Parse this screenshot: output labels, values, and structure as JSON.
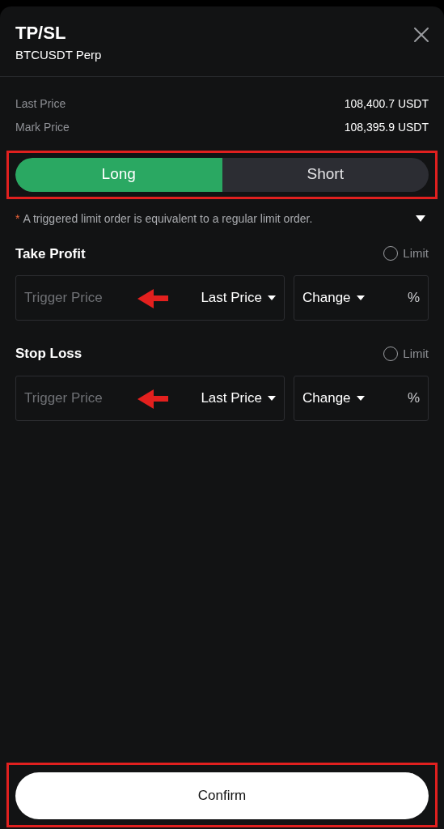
{
  "header": {
    "title": "TP/SL",
    "subtitle": "BTCUSDT Perp"
  },
  "prices": [
    {
      "label": "Last Price",
      "value": "108,400.7 USDT"
    },
    {
      "label": "Mark Price",
      "value": "108,395.9 USDT"
    }
  ],
  "sides": [
    {
      "label": "Long",
      "selected": true
    },
    {
      "label": "Short",
      "selected": false
    }
  ],
  "note": {
    "marker": "*",
    "text": "A triggered limit order is equivalent to a regular limit order."
  },
  "sections": [
    {
      "title": "Take Profit",
      "limit_label": "Limit",
      "limit_checked": false,
      "trigger_placeholder": "Trigger Price",
      "price_type": "Last Price",
      "change_label": "Change",
      "unit": "%"
    },
    {
      "title": "Stop Loss",
      "limit_label": "Limit",
      "limit_checked": false,
      "trigger_placeholder": "Trigger Price",
      "price_type": "Last Price",
      "change_label": "Change",
      "unit": "%"
    }
  ],
  "confirm": "Confirm"
}
